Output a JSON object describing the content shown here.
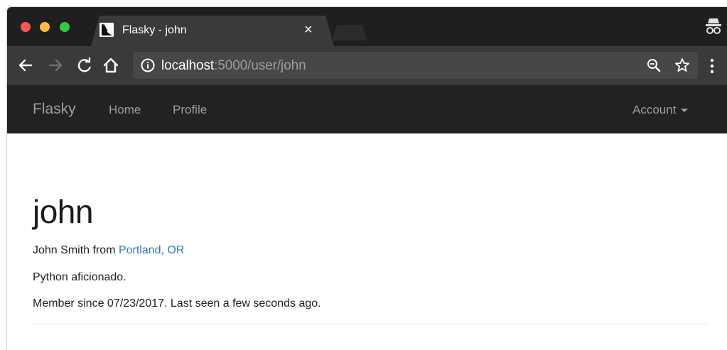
{
  "browser": {
    "tab": {
      "title": "Flasky - john",
      "close_label": "×"
    },
    "address_bar": {
      "host": "localhost",
      "rest": ":5000/user/john"
    },
    "icons": [
      "traffic-light-close",
      "traffic-light-minimize",
      "traffic-light-zoom",
      "flask-favicon",
      "close-icon",
      "incognito-icon",
      "back-arrow-icon",
      "forward-arrow-icon",
      "reload-icon",
      "home-icon",
      "info-icon",
      "zoom-icon",
      "star-icon",
      "menu-kebab-icon"
    ]
  },
  "navbar": {
    "brand": "Flasky",
    "links": [
      {
        "label": "Home"
      },
      {
        "label": "Profile"
      }
    ],
    "account_label": "Account"
  },
  "profile": {
    "username": "john",
    "name_prefix": "John Smith from ",
    "location": "Portland, OR",
    "about": "Python aficionado.",
    "member_line": "Member since 07/23/2017. Last seen a few seconds ago."
  },
  "colors": {
    "navbar_bg": "#222222",
    "navbar_text": "#9d9d9d",
    "link": "#337ab7",
    "chrome_dark": "#1f1f1f",
    "chrome_toolbar": "#3a3a3a"
  }
}
